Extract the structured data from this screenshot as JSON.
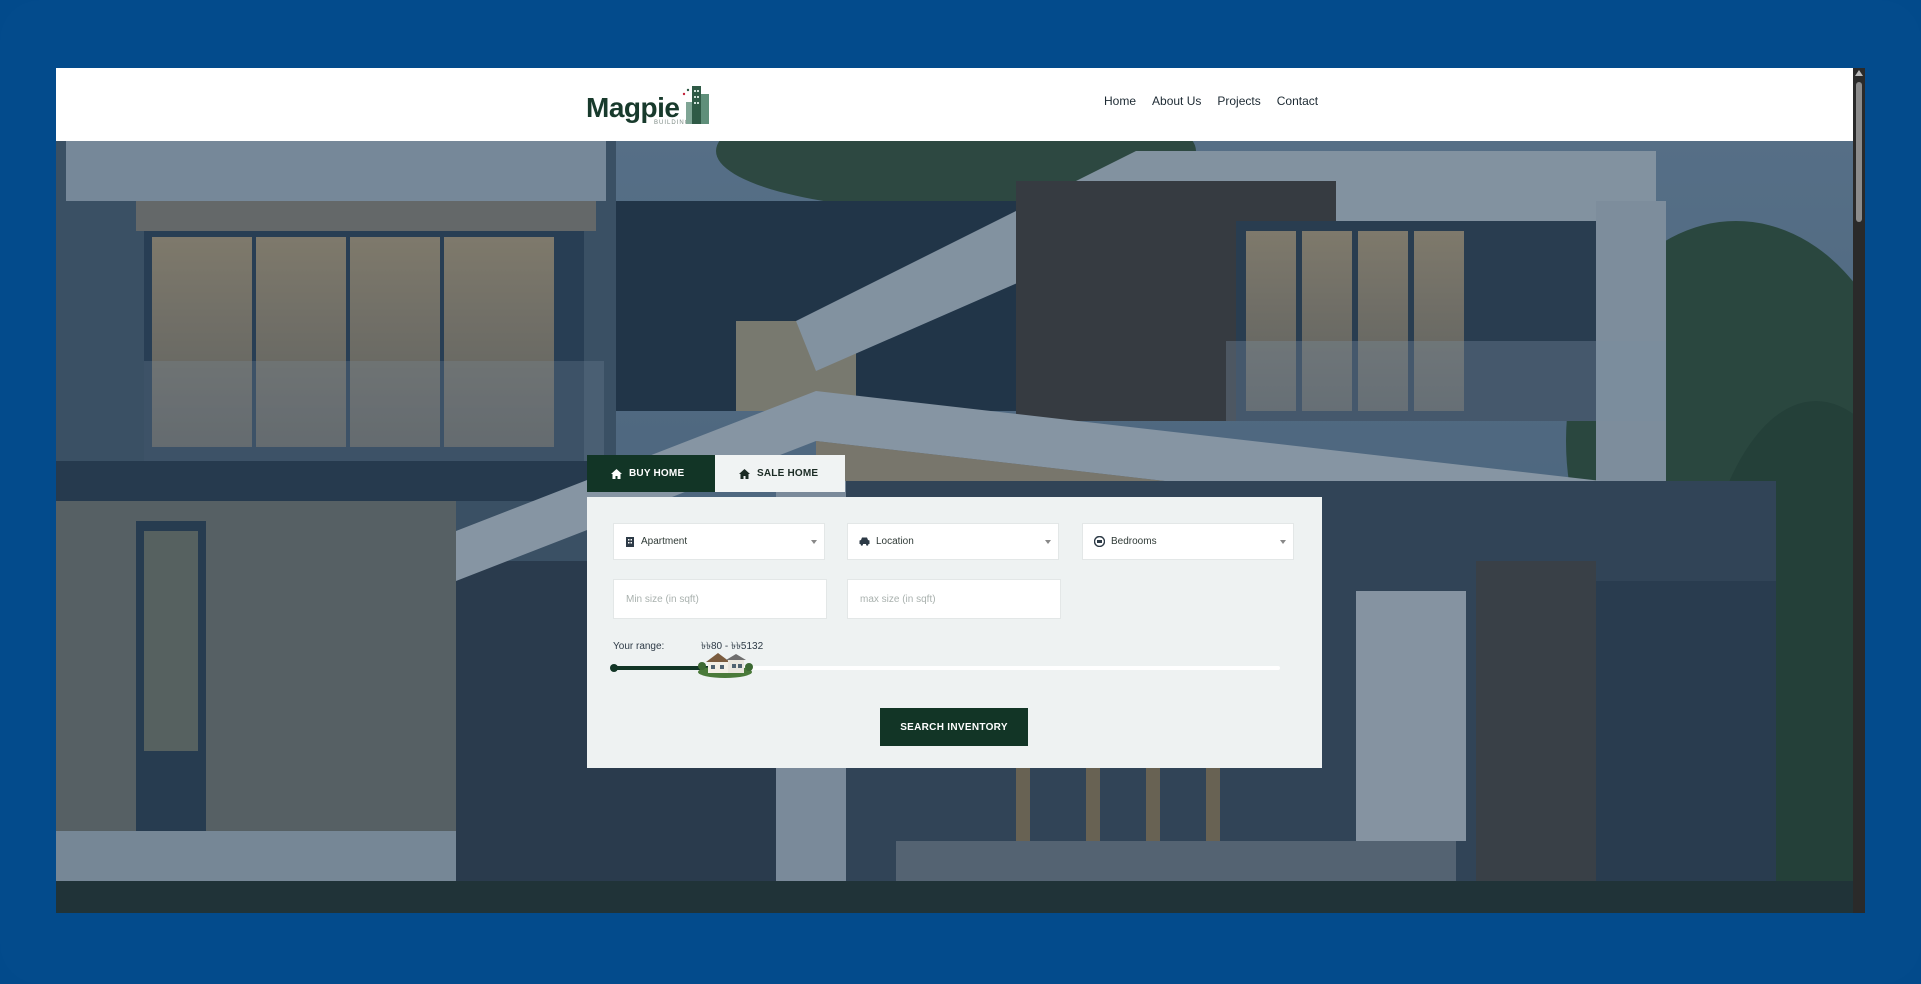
{
  "brand": {
    "name": "Magpie",
    "tagline": "BUILDING LTD"
  },
  "nav": {
    "items": [
      {
        "label": "Home"
      },
      {
        "label": "About Us"
      },
      {
        "label": "Projects"
      },
      {
        "label": "Contact"
      }
    ]
  },
  "search": {
    "tabs": {
      "buy": "BUY HOME",
      "sale": "SALE HOME"
    },
    "type_select": "Apartment",
    "location_select": "Location",
    "bedrooms_select": "Bedrooms",
    "min_size_placeholder": "Min size (in sqft)",
    "max_size_placeholder": "max size (in sqft)",
    "range_label": "Your range:",
    "range_values": "৳৳80 - ৳৳5132",
    "range_fill_fraction": 0.16,
    "button_label": "SEARCH INVENTORY"
  },
  "colors": {
    "frame": "#034b8c",
    "brand_green": "#123526",
    "panel_bg": "#eef2f2"
  }
}
